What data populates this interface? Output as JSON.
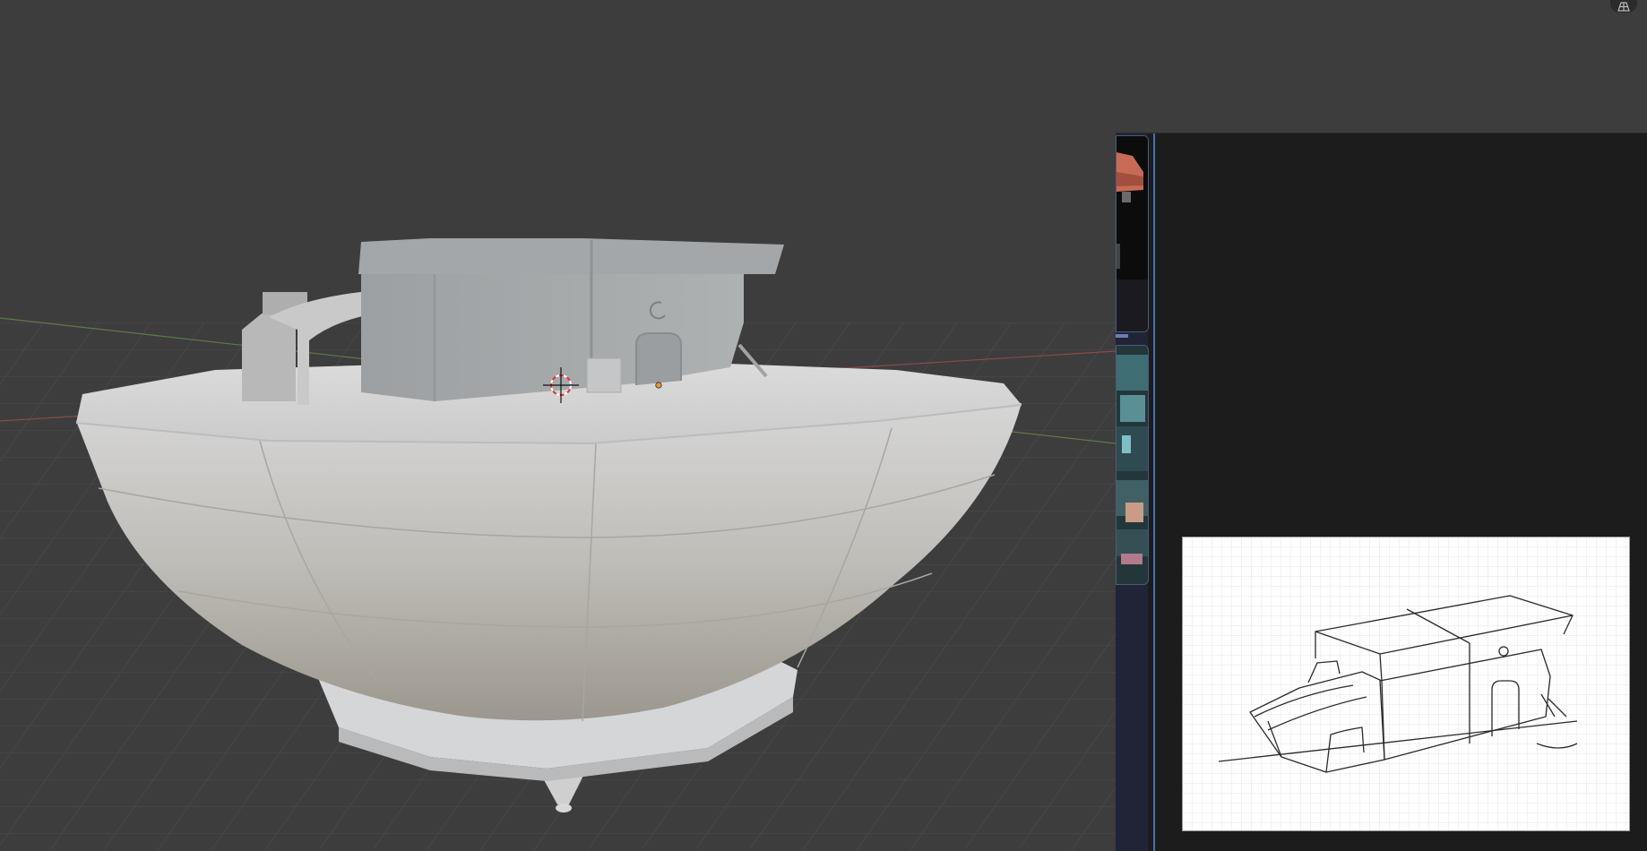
{
  "viewport": {
    "background": "#3d3d3d",
    "model_color": "#c8c8c6",
    "icons": [
      "3d-cursor-icon",
      "origin-point-icon",
      "grid-view-icon"
    ]
  },
  "reference_panel": {
    "background": "#1c1c1c",
    "thumbnail_strip_color": "#202436",
    "divider_color": "#4772b3",
    "thumbnails": [
      "thumbnail-red-machine",
      "thumbnail-cyberpunk-scene"
    ],
    "sketch": "reference-sketch-image"
  }
}
